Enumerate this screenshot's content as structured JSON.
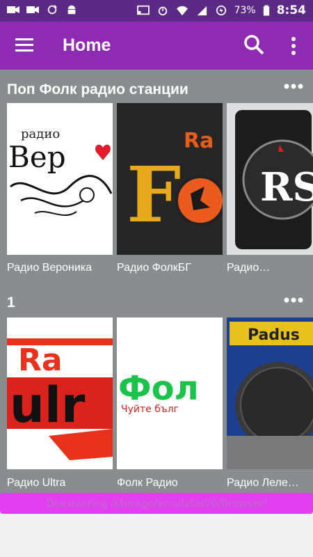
{
  "status_bar": {
    "battery_percent": "73%",
    "time": "8:54",
    "icons": [
      "video-icon",
      "video-icon",
      "sync-icon",
      "android-icon",
      "cast-icon",
      "alarm-icon",
      "wifi-icon",
      "no-sim-icon",
      "data-saver-icon"
    ]
  },
  "app_bar": {
    "title": "Home",
    "icons": [
      "menu-icon",
      "search-icon",
      "more-vert-icon"
    ]
  },
  "sections": [
    {
      "title": "Поп Фолк радио станции",
      "items": [
        {
          "label": "Радио Вероника",
          "logo_text": "Вер"
        },
        {
          "label": "Радио ФолкБГ",
          "logo_text": "Fo"
        },
        {
          "label": "Радио…",
          "logo_text": "RS"
        }
      ]
    },
    {
      "title": "1",
      "items": [
        {
          "label": "Радио Ultra",
          "logo_text": "Ra ulr"
        },
        {
          "label": "Фолк Радио",
          "logo_text": "Фол",
          "sub": "Чуйте бълг"
        },
        {
          "label": "Радио Леле…",
          "logo_text": "Padus"
        }
      ]
    }
  ],
  "toast": "Discovering /storage/emulated/0/Browser/",
  "colors": {
    "status_bar": "#5c2a86",
    "app_bar": "#8e2bb2",
    "content_bg": "#8a8d8e",
    "toast": "#e23ff0"
  }
}
